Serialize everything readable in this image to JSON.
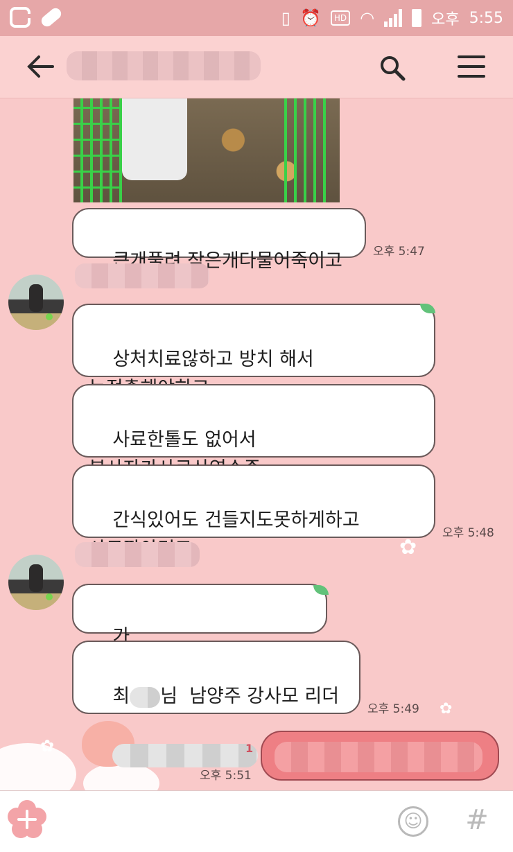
{
  "status_bar": {
    "ampm": "오후",
    "time": "5:55",
    "hd": "HD",
    "icons": [
      "g-app-icon",
      "pill-icon",
      "vibrate-icon",
      "alarm-icon",
      "hd-icon",
      "wifi-icon",
      "signal-icon",
      "battery-icon"
    ]
  },
  "header": {
    "title": "",
    "icons": [
      "back-arrow-icon",
      "search-icon",
      "menu-icon"
    ]
  },
  "messages": [
    {
      "type": "text",
      "text": "큰개풀려 작은개다물어죽이고",
      "time": "오후 5:47"
    },
    {
      "type": "text",
      "text": "상처치료않하고 방치 해서\n눈적출해야하고"
    },
    {
      "type": "text",
      "text": "사료한톨도 없어서\n봉사자가사료산영수증"
    },
    {
      "type": "text",
      "text": "간식있어도 건들지도못하게하고\n사료팔아먹고",
      "time": "오후 5:48"
    },
    {
      "type": "text",
      "text": "가"
    },
    {
      "type": "text",
      "line1": "최",
      "line1b": "님  남양주 강사모 리더",
      "time": "오후 5:49"
    }
  ],
  "my_message": {
    "unread": "1",
    "time": "오후 5:51"
  },
  "input_bar": {
    "hash": "#"
  },
  "colors": {
    "background": "#f9c9c9",
    "header": "#fbd2d1",
    "my_bubble": "#ee7f84",
    "status_bar": "#e6a7a8"
  }
}
